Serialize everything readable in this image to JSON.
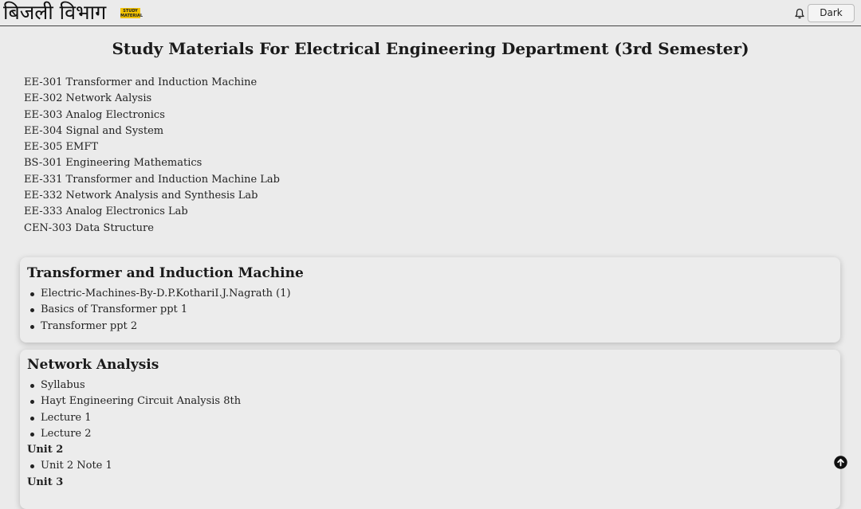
{
  "header": {
    "logo_text": "बिजली विभाग",
    "logo_badge": "STUDY MATERIAL",
    "dark_label": "Dark",
    "icons": {
      "notifications": "bell-icon",
      "scroll_top": "arrow-up-circle-icon"
    }
  },
  "page_title": "Study Materials For Electrical Engineering Department (3rd Semester)",
  "subjects": [
    "EE-301 Transformer and Induction Machine",
    "EE-302 Network Aalysis",
    "EE-303 Analog Electronics",
    "EE-304 Signal and System",
    "EE-305 EMFT",
    "BS-301 Engineering Mathematics",
    "EE-331 Transformer and Induction Machine Lab",
    "EE-332 Network Analysis and Synthesis Lab",
    "EE-333 Analog Electronics Lab",
    "CEN-303 Data Structure"
  ],
  "sections": [
    {
      "title": "Transformer and Induction Machine",
      "items": [
        "Electric-Machines-By-D.P.KothariI.J.Nagrath (1)",
        "Basics of Transformer ppt 1",
        "Transformer ppt 2"
      ]
    },
    {
      "title": "Network Analysis",
      "items": [
        "Syllabus",
        "Hayt Engineering Circuit Analysis 8th",
        "Lecture 1",
        "Lecture 2"
      ],
      "unit2_heading": "Unit 2",
      "unit2_items": [
        "Unit 2 Note 1"
      ],
      "unit3_heading": "Unit 3"
    }
  ],
  "colors": {
    "background": "#ebebeb",
    "badge": "#f3c300",
    "text": "#222222"
  }
}
